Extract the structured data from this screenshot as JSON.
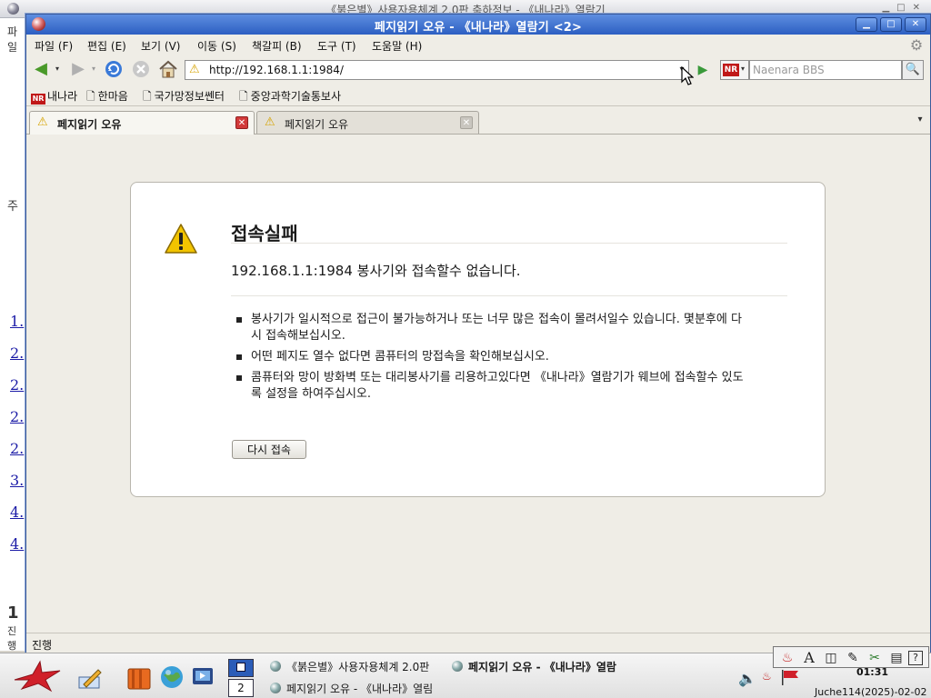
{
  "background_window": {
    "title": "《붉은별》사용자용체계 2.0판 축하정보 - 《내나라》열람기",
    "left_stubs": [
      "1.",
      "2.",
      "2.",
      "2.",
      "2.",
      "3.",
      "4.",
      "4."
    ],
    "left_misc_top": "파일",
    "left_misc_mid": "주",
    "left_misc_bottom": "1",
    "left_status": "진행"
  },
  "window": {
    "title": "페지읽기 오유 - 《내나라》열람기 <2>",
    "controls": {
      "minimize": "▁",
      "maximize": "□",
      "close": "✕"
    }
  },
  "menu": [
    "파일 (F)",
    "편집 (E)",
    "보기 (V)",
    "이동 (S)",
    "책갈피 (B)",
    "도구 (T)",
    "도움말 (H)"
  ],
  "navigation": {
    "url": "http://192.168.1.1:1984/",
    "search_placeholder": "Naenara BBS",
    "search_engine_logo": "NR"
  },
  "bookmarks": [
    {
      "label": "내나라",
      "icon": "naenara-logo-icon"
    },
    {
      "label": "한마음",
      "icon": "page-icon"
    },
    {
      "label": "국가망정보쎈터",
      "icon": "page-icon"
    },
    {
      "label": "중앙과학기술통보사",
      "icon": "page-icon"
    }
  ],
  "tabs": [
    {
      "label": "페지읽기 오유",
      "active": true
    },
    {
      "label": "페지읽기 오유",
      "active": false
    }
  ],
  "error": {
    "title": "접속실패",
    "description": "192.168.1.1:1984 봉사기와 접속할수 없습니다.",
    "bullets": [
      "봉사기가 일시적으로 접근이 불가능하거나 또는 너무 많은 접속이 몰려서일수 있습니다. 몇분후에 다시 접속해보십시오.",
      "어떤 페지도 열수 없다면 콤퓨터의 망접속을 확인해보십시오.",
      "콤퓨터와 망이 방화벽 또는 대리봉사기를 리용하고있다면 《내나라》열람기가 웨브에 접속할수 있도록 설정을 하여주십시오."
    ],
    "retry_label": "다시 접속"
  },
  "status": "진행",
  "taskbar": {
    "pager_current": "1",
    "pager_other": "2",
    "tasks": [
      "《붉은별》사용자용체계 2.0판",
      "페지읽기 오유 - 《내나라》열람",
      "페지읽기 오유 - 《내나라》열림"
    ],
    "clock": "01:31",
    "date": "Juche114(2025)-02-02"
  },
  "colors": {
    "titlebar": "#2c5fc2",
    "accent_red": "#c01818",
    "warning": "#d6a300"
  }
}
